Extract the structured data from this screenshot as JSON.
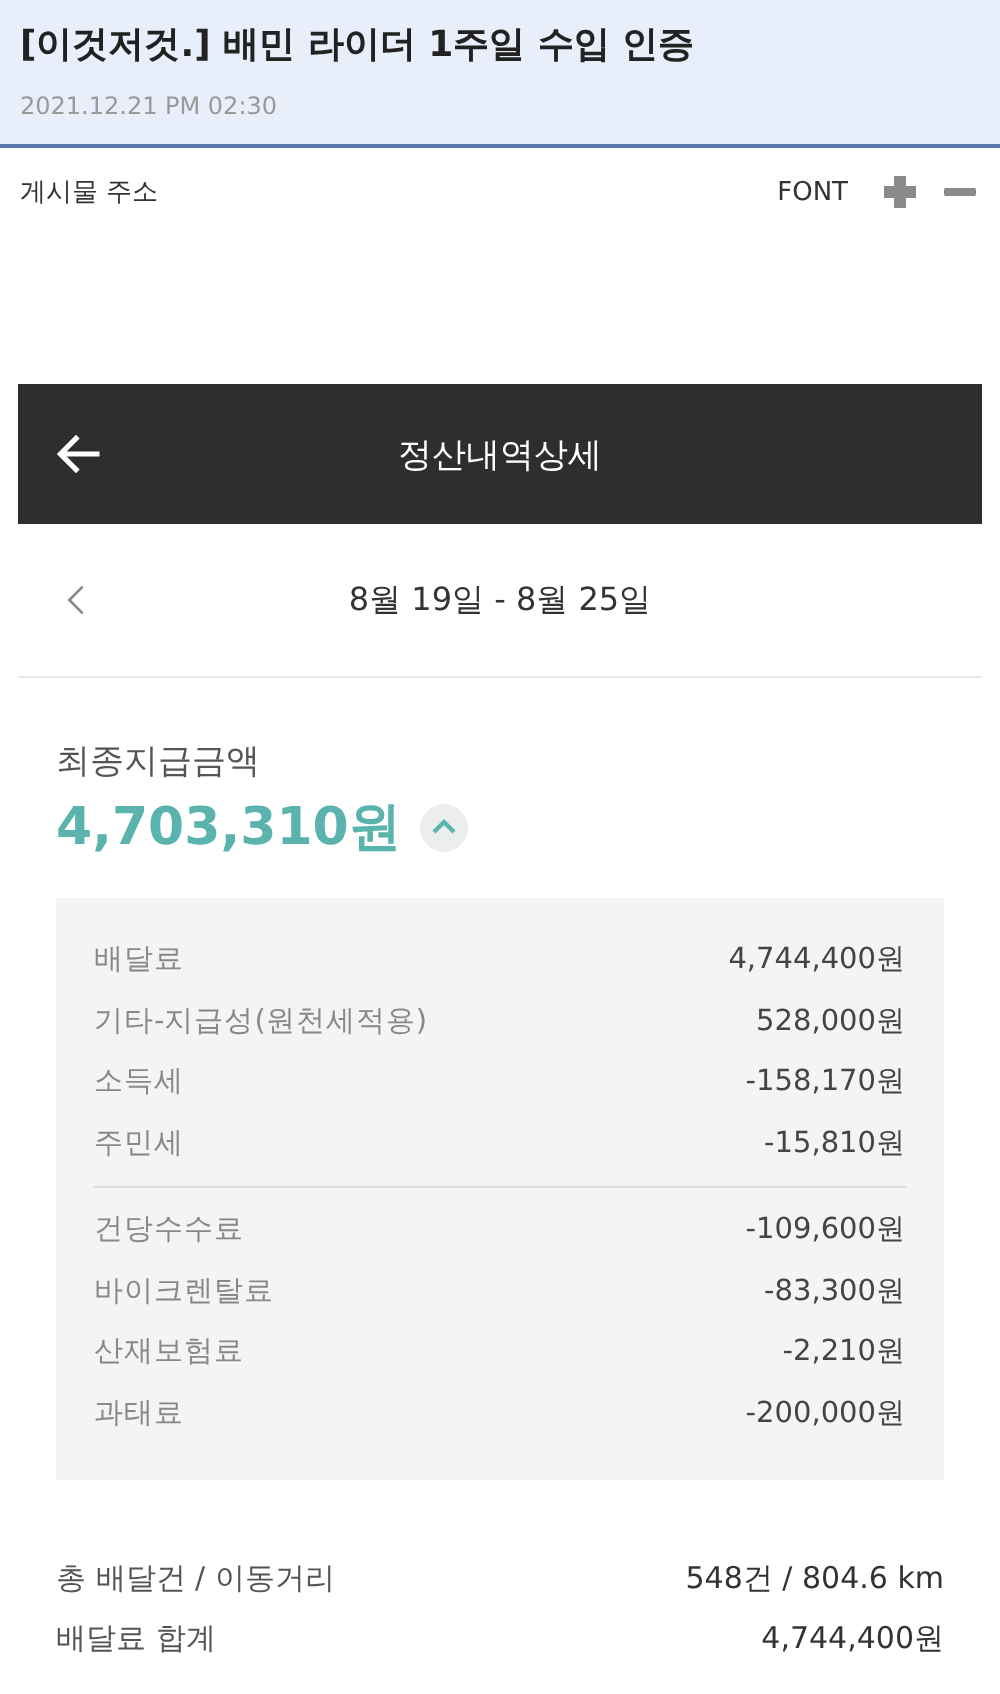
{
  "post": {
    "title": "[이것저것.] 배민 라이더 1주일 수입 인증",
    "date": "2021.12.21 PM 02:30",
    "address_label": "게시물 주소",
    "font_label": "FONT"
  },
  "app": {
    "title": "정산내역상세",
    "period": "8월 19일 - 8월 25일",
    "final_label": "최종지급금액",
    "final_amount": "4,703,310원",
    "expanded": true,
    "detail_groups": [
      {
        "items": [
          {
            "label": "배달료",
            "value": "4,744,400원"
          },
          {
            "label": "기타-지급성(원천세적용)",
            "value": "528,000원"
          },
          {
            "label": "소득세",
            "value": "-158,170원"
          },
          {
            "label": "주민세",
            "value": "-15,810원"
          }
        ]
      },
      {
        "items": [
          {
            "label": "건당수수료",
            "value": "-109,600원"
          },
          {
            "label": "바이크렌탈료",
            "value": "-83,300원"
          },
          {
            "label": "산재보험료",
            "value": "-2,210원"
          },
          {
            "label": "과태료",
            "value": "-200,000원"
          }
        ]
      }
    ],
    "summary": [
      {
        "label": "총 배달건 / 이동거리",
        "value": "548건 / 804.6 km"
      },
      {
        "label": "배달료 합계",
        "value": "4,744,400원"
      }
    ]
  }
}
